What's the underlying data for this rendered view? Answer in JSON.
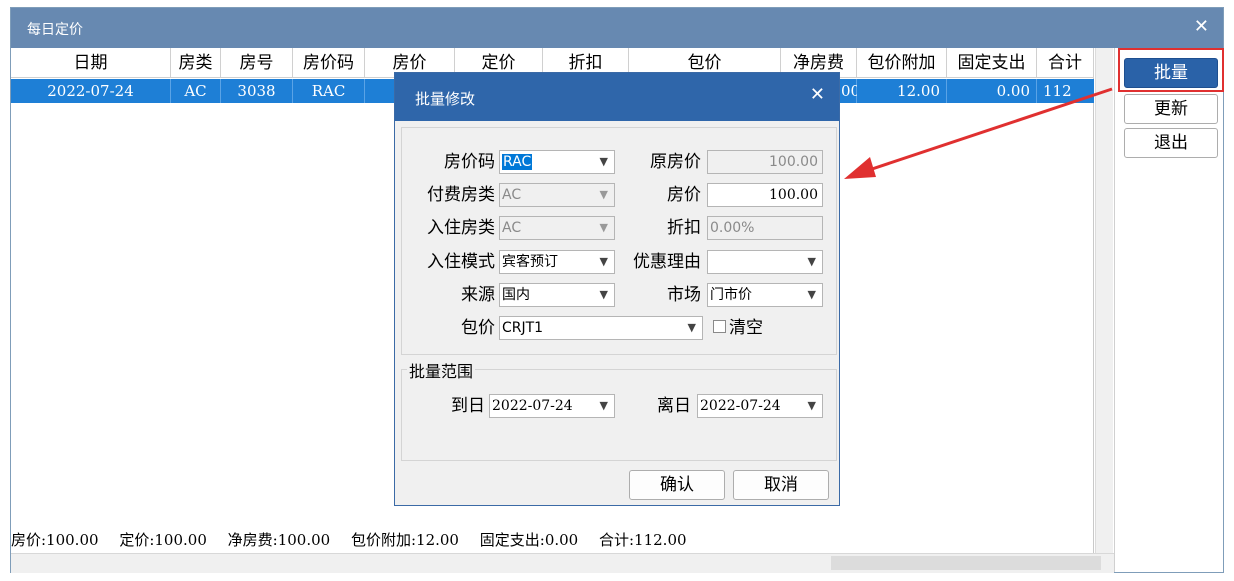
{
  "window": {
    "title": "每日定价"
  },
  "table": {
    "headers": [
      "日期",
      "房类",
      "房号",
      "房价码",
      "房价",
      "定价",
      "折扣",
      "包价",
      "净房费",
      "包价附加",
      "固定支出",
      "合计"
    ],
    "row": {
      "date": "2022-07-24",
      "room_type": "AC",
      "room_no": "3038",
      "rate_code": "RAC",
      "net_fee_partial": "00",
      "package_extra": "12.00",
      "fixed_expense": "0.00",
      "total_partial": "112"
    }
  },
  "summary": {
    "room_price": "房价:100.00",
    "fixed_price": "定价:100.00",
    "net_fee": "净房费:100.00",
    "package_extra": "包价附加:12.00",
    "fixed_expense": "固定支出:0.00",
    "total": "合计:112.00"
  },
  "side": {
    "batch": "批量",
    "update": "更新",
    "exit": "退出"
  },
  "dialog": {
    "title": "批量修改",
    "rate_code_label": "房价码",
    "rate_code": "RAC",
    "orig_price_label": "原房价",
    "orig_price": "100.00",
    "pay_type_label": "付费房类",
    "pay_type": "AC",
    "price_label": "房价",
    "price": "100.00",
    "checkin_type_label": "入住房类",
    "checkin_type": "AC",
    "discount_label": "折扣",
    "discount": "0.00%",
    "mode_label": "入住模式",
    "mode": "宾客预订",
    "reason_label": "优惠理由",
    "reason": "",
    "source_label": "来源",
    "source": "国内",
    "market_label": "市场",
    "market": "门市价",
    "package_label": "包价",
    "package": "CRJT1",
    "clear_label": "清空",
    "range_label": "批量范围",
    "arrive_label": "到日",
    "arrive": "2022-07-24",
    "depart_label": "离日",
    "depart": "2022-07-24",
    "confirm": "确认",
    "cancel": "取消"
  },
  "colors": {
    "title_bar": "#6789b1",
    "dialog_title": "#2f66aa",
    "selection": "#1e7fd6",
    "highlight": "#e03030"
  }
}
